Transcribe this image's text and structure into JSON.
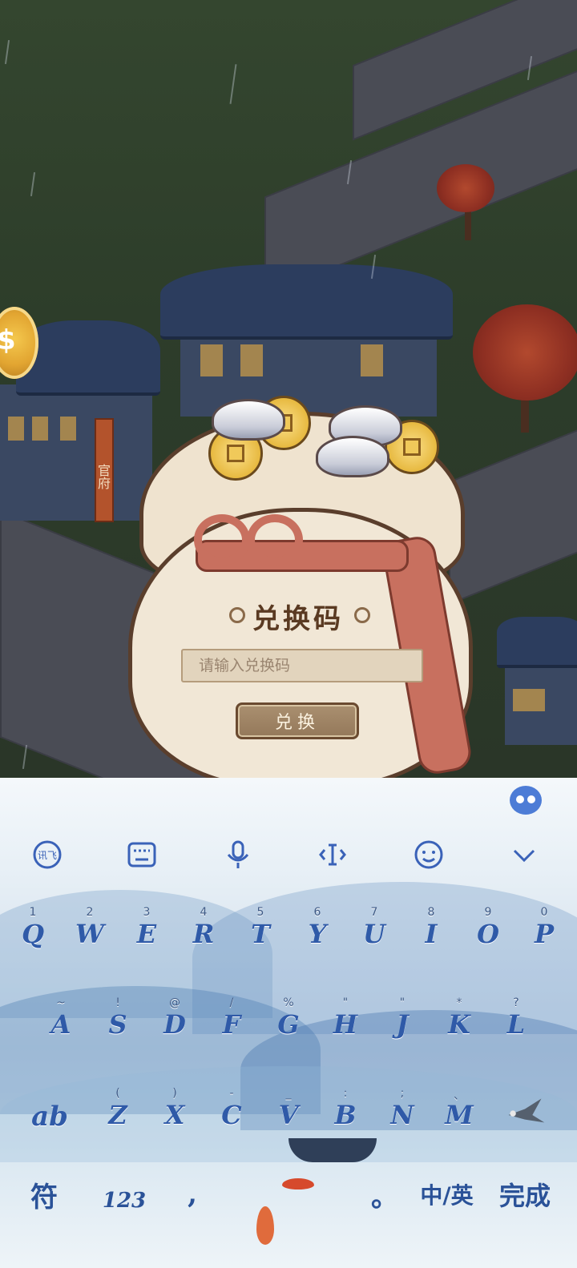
{
  "game": {
    "government_sign": "官府",
    "redeem": {
      "title": "兑换码",
      "input_placeholder": "请输入兑换码",
      "button_label": "兑换"
    }
  },
  "keyboard": {
    "toolbar": [
      "voice-input-icon",
      "keyboard-layout-icon",
      "microphone-icon",
      "cursor-icon",
      "emoji-icon",
      "collapse-icon"
    ],
    "row1": [
      {
        "label": "Q",
        "hint": "1"
      },
      {
        "label": "W",
        "hint": "2"
      },
      {
        "label": "E",
        "hint": "3"
      },
      {
        "label": "R",
        "hint": "4"
      },
      {
        "label": "T",
        "hint": "5"
      },
      {
        "label": "Y",
        "hint": "6"
      },
      {
        "label": "U",
        "hint": "7"
      },
      {
        "label": "I",
        "hint": "8"
      },
      {
        "label": "O",
        "hint": "9"
      },
      {
        "label": "P",
        "hint": "0"
      }
    ],
    "row2": [
      {
        "label": "A",
        "hint": "~"
      },
      {
        "label": "S",
        "hint": "!"
      },
      {
        "label": "D",
        "hint": "@"
      },
      {
        "label": "F",
        "hint": "/"
      },
      {
        "label": "G",
        "hint": "%"
      },
      {
        "label": "H",
        "hint": "\""
      },
      {
        "label": "J",
        "hint": "\""
      },
      {
        "label": "K",
        "hint": "*"
      },
      {
        "label": "L",
        "hint": "?"
      }
    ],
    "row3": [
      {
        "label": "Z",
        "hint": "("
      },
      {
        "label": "X",
        "hint": ")"
      },
      {
        "label": "C",
        "hint": "-"
      },
      {
        "label": "V",
        "hint": "_"
      },
      {
        "label": "B",
        "hint": ":"
      },
      {
        "label": "N",
        "hint": ";"
      },
      {
        "label": "M",
        "hint": "、"
      }
    ],
    "case_key": "ab",
    "symbol_key": "符",
    "number_key": "123",
    "comma_key": ",",
    "period_key": "。",
    "lang_key": "中/英",
    "done_key": "完成"
  }
}
